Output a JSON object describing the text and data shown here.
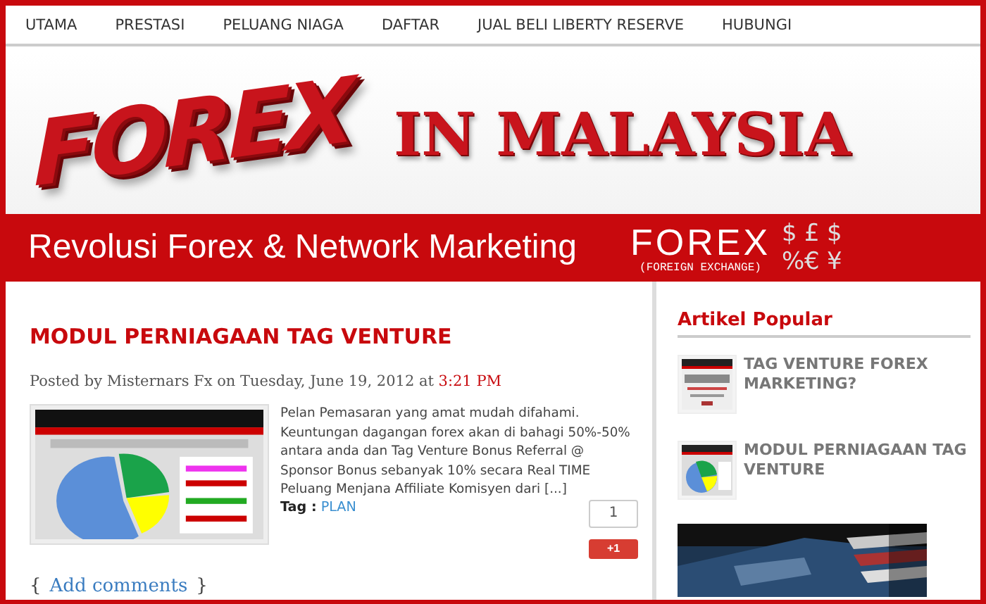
{
  "nav": [
    {
      "label": "UTAMA"
    },
    {
      "label": "PRESTASI"
    },
    {
      "label": "PELUANG NIAGA"
    },
    {
      "label": "DAFTAR"
    },
    {
      "label": "JUAL BELI LIBERTY RESERVE"
    },
    {
      "label": "HUBUNGI"
    }
  ],
  "banner": {
    "logo_word": "FOREX",
    "headline": "IN MALAYSIA",
    "tagline": "Revolusi Forex & Network Marketing",
    "sketch_word": "FOREX",
    "sketch_note": "(FOREIGN EXCHANGE)",
    "symbols": [
      "$",
      "£",
      "$",
      "%",
      "€",
      "¥"
    ]
  },
  "post": {
    "title": "MODUL PERNIAGAAN TAG VENTURE",
    "byline": "Posted by Misternars Fx on Tuesday, June 19, 2012 at",
    "time": "3:21 PM",
    "summary": "Pelan Pemasaran yang amat mudah difahami. Keuntungan dagangan forex akan di bahagi 50%-50% antara anda dan Tag Venture Bonus Referral @ Sponsor Bonus sebanyak 10% secara Real TIME Peluang Menjana Affiliate Komisyen dari [...]",
    "tag_label": "Tag :",
    "tag": "PLAN",
    "plus_count": "1",
    "plus_label": "+1",
    "comments_open": "{",
    "comments": "Add comments",
    "comments_close": "}"
  },
  "sidebar": {
    "heading": "Artikel Popular",
    "items": [
      {
        "title": "TAG VENTURE FOREX MARKETING?",
        "kind": "welcome"
      },
      {
        "title": "MODUL PERNIAGAAN TAG VENTURE",
        "kind": "pie"
      }
    ]
  }
}
